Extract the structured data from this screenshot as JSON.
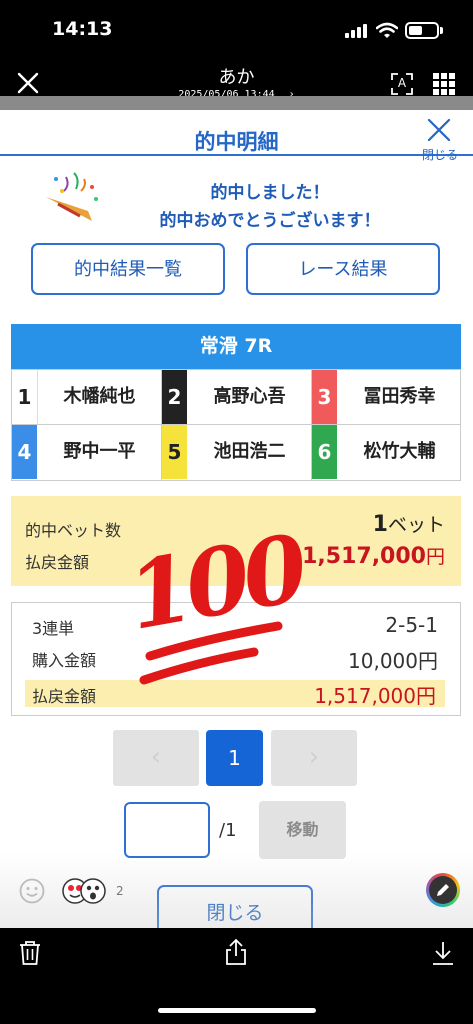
{
  "status_bar": {
    "time": "14:13"
  },
  "header": {
    "title": "あか",
    "date": "2025/05/06 13:44",
    "date_chevron": "›",
    "ocr_label": "A"
  },
  "modal": {
    "title": "的中明細",
    "close_label": "閉じる",
    "message_line1": "的中しました！",
    "message_line2": "的中おめでとうございます！",
    "buttons": {
      "hit_list": "的中結果一覧",
      "race_result": "レース結果"
    },
    "race": {
      "name": "常滑 7R",
      "racers": [
        {
          "lane": "1",
          "name": "木幡純也",
          "color": "#ffffff",
          "text_color": "#222222"
        },
        {
          "lane": "2",
          "name": "高野心吾",
          "color": "#222222",
          "text_color": "#ffffff"
        },
        {
          "lane": "3",
          "name": "冨田秀幸",
          "color": "#f05a5a",
          "text_color": "#ffffff"
        },
        {
          "lane": "4",
          "name": "野中一平",
          "color": "#3b8ee8",
          "text_color": "#ffffff"
        },
        {
          "lane": "5",
          "name": "池田浩二",
          "color": "#f5e23a",
          "text_color": "#222222"
        },
        {
          "lane": "6",
          "name": "松竹大輔",
          "color": "#2fa84f",
          "text_color": "#ffffff"
        }
      ]
    },
    "summary": {
      "bet_count_label": "的中ベット数",
      "bet_count_num": "1",
      "bet_count_unit": "ベット",
      "payout_label": "払戻金額",
      "payout_num": "1,517,000",
      "payout_unit": "円"
    },
    "detail": {
      "bet_type": "3連単",
      "combination": "2-5-1",
      "purchase_label": "購入金額",
      "purchase_value": "10,000円",
      "payout_label": "払戻金額",
      "payout_value": "1,517,000円"
    },
    "pagination": {
      "prev": "‹",
      "current": "1",
      "next": "›",
      "total": "/1",
      "move": "移動"
    },
    "close_button": "閉じる"
  },
  "sticker": {
    "text": "100",
    "color": "#e01818"
  },
  "reactions": {
    "count": "2"
  },
  "colors": {
    "accent": "#2567c7",
    "highlight": "#fbeeaf",
    "payout_red": "#c8141e"
  }
}
